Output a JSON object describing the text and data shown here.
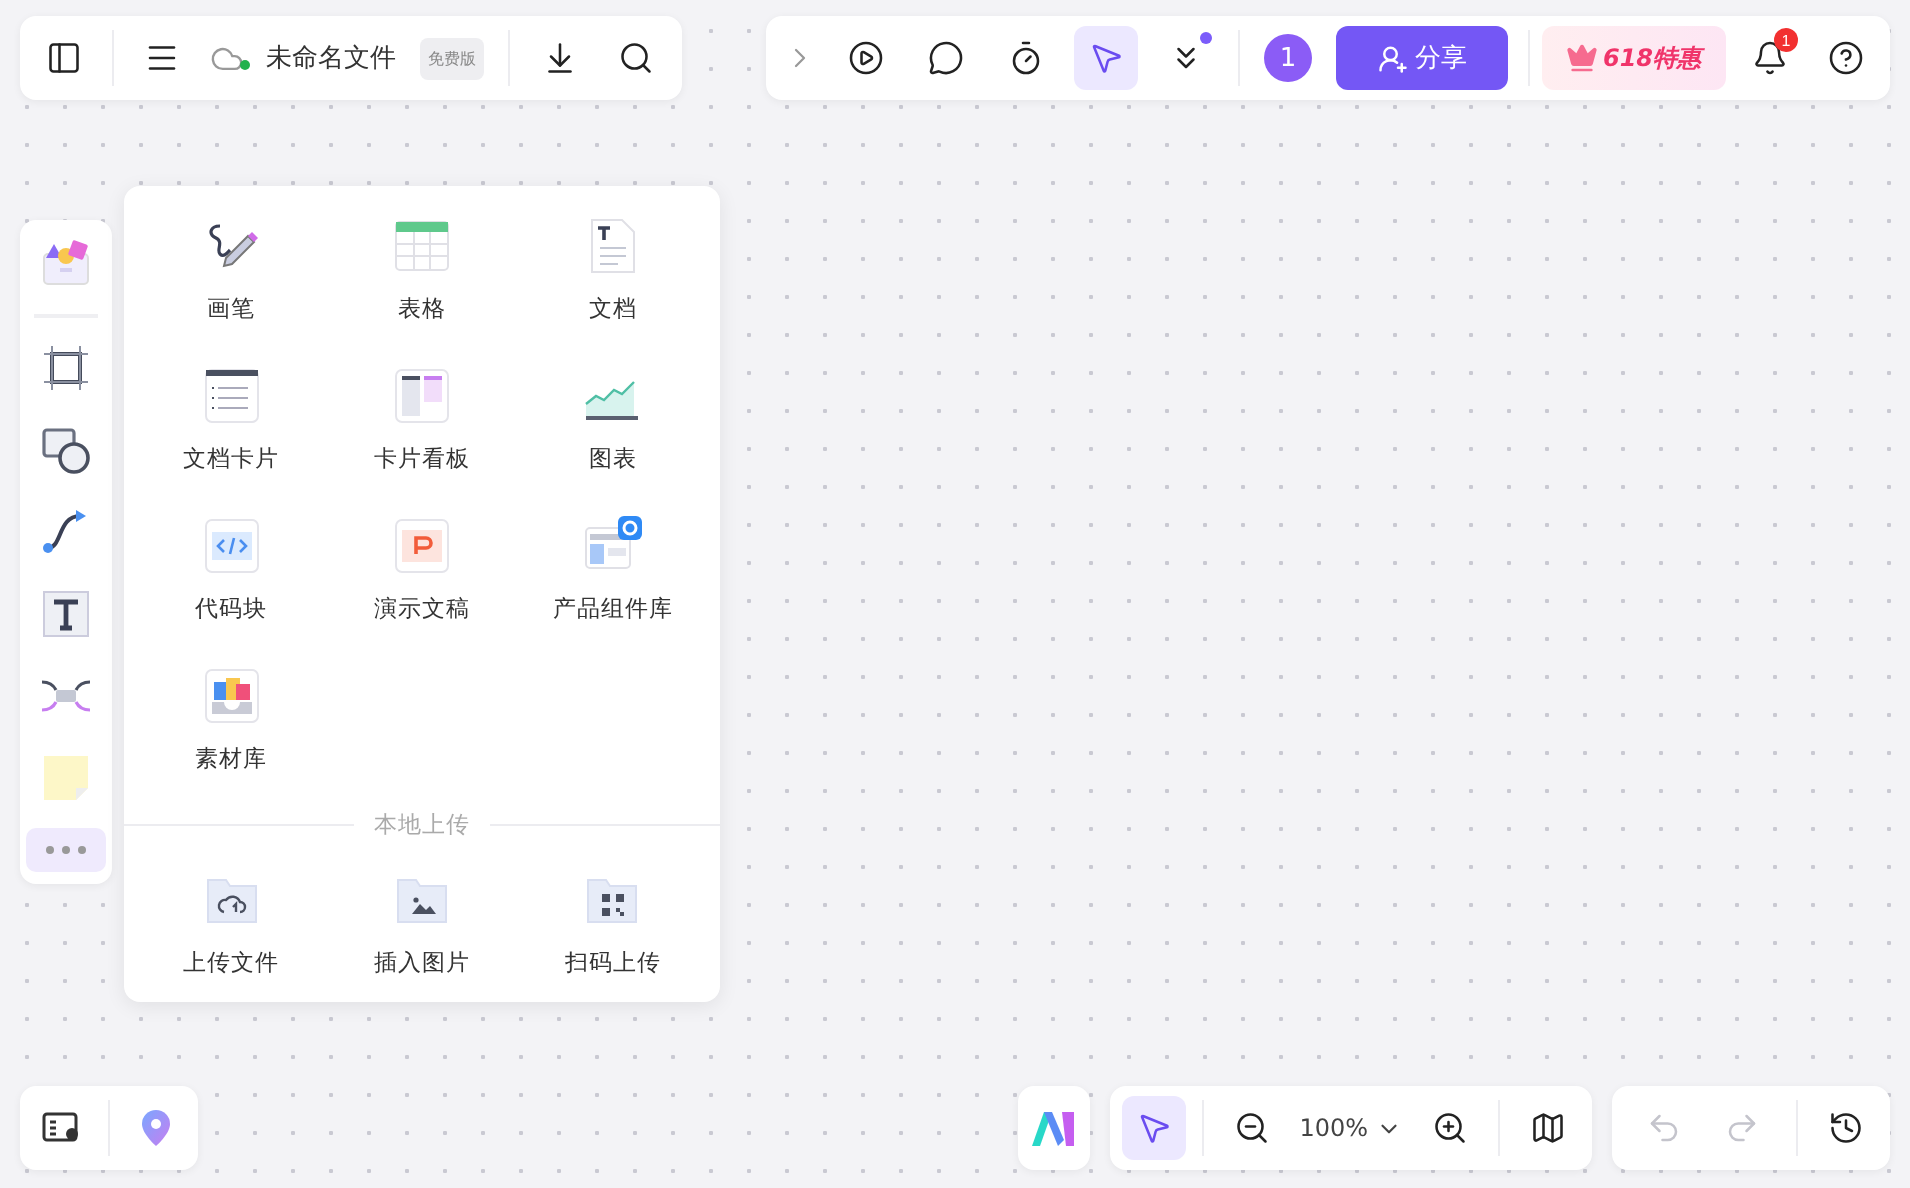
{
  "file_bar": {
    "title": "未命名文件",
    "badge": "免费版",
    "synced": true
  },
  "top_toolbar": {
    "tools": [
      {
        "kind": "present",
        "selected": false,
        "notified": false
      },
      {
        "kind": "comment",
        "selected": false,
        "notified": false
      },
      {
        "kind": "timer",
        "selected": false,
        "notified": false
      },
      {
        "kind": "laser",
        "selected": true,
        "notified": false
      },
      {
        "kind": "more",
        "selected": false,
        "notified": true
      }
    ],
    "collaborator_count": "1",
    "share_button": "分享",
    "promo": "618特惠",
    "notification_count": "1"
  },
  "left_rail": {
    "tools": [
      {
        "kind": "templates",
        "selected": false
      },
      {
        "kind": "frame",
        "selected": false
      },
      {
        "kind": "shape",
        "selected": false
      },
      {
        "kind": "connector",
        "selected": false
      },
      {
        "kind": "text",
        "selected": false
      },
      {
        "kind": "mindmap",
        "selected": false
      },
      {
        "kind": "sticky",
        "selected": false
      },
      {
        "kind": "more",
        "selected": true
      }
    ]
  },
  "insert_panel": {
    "items": [
      {
        "kind": "pen",
        "label": "画笔"
      },
      {
        "kind": "table",
        "label": "表格"
      },
      {
        "kind": "doc",
        "label": "文档"
      },
      {
        "kind": "doc_card",
        "label": "文档卡片"
      },
      {
        "kind": "kanban",
        "label": "卡片看板"
      },
      {
        "kind": "chart",
        "label": "图表"
      },
      {
        "kind": "code",
        "label": "代码块"
      },
      {
        "kind": "slides",
        "label": "演示文稿"
      },
      {
        "kind": "components",
        "label": "产品组件库"
      },
      {
        "kind": "assets",
        "label": "素材库"
      }
    ],
    "section_title": "本地上传",
    "uploads": [
      {
        "kind": "file",
        "label": "上传文件"
      },
      {
        "kind": "image",
        "label": "插入图片"
      },
      {
        "kind": "qr",
        "label": "扫码上传"
      }
    ]
  },
  "zoom_bar": {
    "pointer_selected": true,
    "zoom": "100%"
  },
  "history_bar": {
    "undo_disabled": true,
    "redo_disabled": true
  }
}
